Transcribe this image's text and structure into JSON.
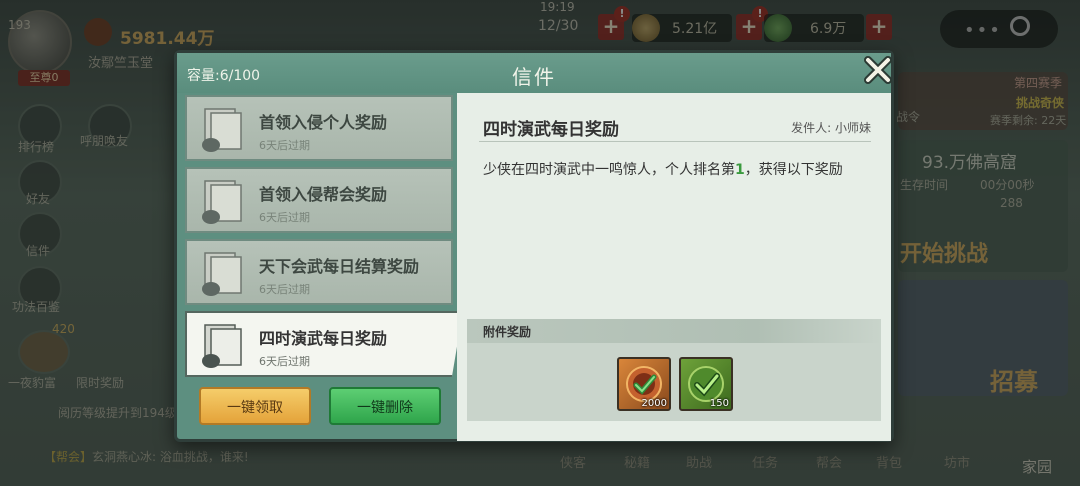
{
  "hud": {
    "player_level": "193",
    "vip_label": "至尊0",
    "power_value": "5981.44万",
    "guild_name": "汝鄢竺玉堂",
    "clock": "19:19",
    "stamina": "12/30",
    "copper": "5.21亿",
    "jade": "6.9万",
    "plus": "+",
    "badge": "!"
  },
  "sidebar": {
    "items": [
      {
        "label": "排行榜"
      },
      {
        "label": "呼朋唤友"
      },
      {
        "label": "好友"
      },
      {
        "label": "信件"
      },
      {
        "label": "功法百鉴"
      }
    ],
    "bottom_items": [
      {
        "label": "一夜豹富"
      },
      {
        "label": "限时奖励"
      }
    ],
    "frog_badge": "420"
  },
  "right_panel": {
    "season_tag": "第四赛季",
    "season_title": "挑战奇侠",
    "season_remain": "赛季剩余: 22天",
    "cave_title": "93.万佛高窟",
    "survive_label": "生存时间",
    "survive_time": "00分00秒",
    "cave_count": "288",
    "start_btn": "开始挑战",
    "recruit": "招募",
    "fight_tag": "战令"
  },
  "level_line": "阅历等级提升到194级",
  "chat": {
    "tag": "【帮会】",
    "text": "玄洞燕心冰: 浴血挑战，谁来!"
  },
  "bottom_tabs": [
    "侠客",
    "秘籍",
    "助战",
    "任务",
    "帮会",
    "背包",
    "坊市",
    "家园"
  ],
  "mail": {
    "capacity_label": "容量:6/100",
    "title": "信件",
    "close_icon": "close-x-icon",
    "items": [
      {
        "title": "首领入侵个人奖励",
        "expire": "6天后过期",
        "active": false
      },
      {
        "title": "首领入侵帮会奖励",
        "expire": "6天后过期",
        "active": false
      },
      {
        "title": "天下会武每日结算奖励",
        "expire": "6天后过期",
        "active": false
      },
      {
        "title": "四时演武每日奖励",
        "expire": "6天后过期",
        "active": true
      }
    ],
    "claim_all": "一键领取",
    "delete_all": "一键删除",
    "detail": {
      "title": "四时演武每日奖励",
      "sender": "发件人: 小师妹",
      "body_before": "少侠在四时演武中一鸣惊人，个人排名第",
      "rank": "1",
      "body_after": "，获得以下奖励",
      "attach_label": "附件奖励",
      "rewards": [
        {
          "name": "orange-token-icon",
          "count": "2000"
        },
        {
          "name": "green-token-icon",
          "count": "150"
        }
      ]
    }
  },
  "colors": {
    "dialog": "#5d8f80",
    "claim": "#f0b84f",
    "delete": "#3bb55a",
    "rank_highlight": "#3a9a3e"
  }
}
